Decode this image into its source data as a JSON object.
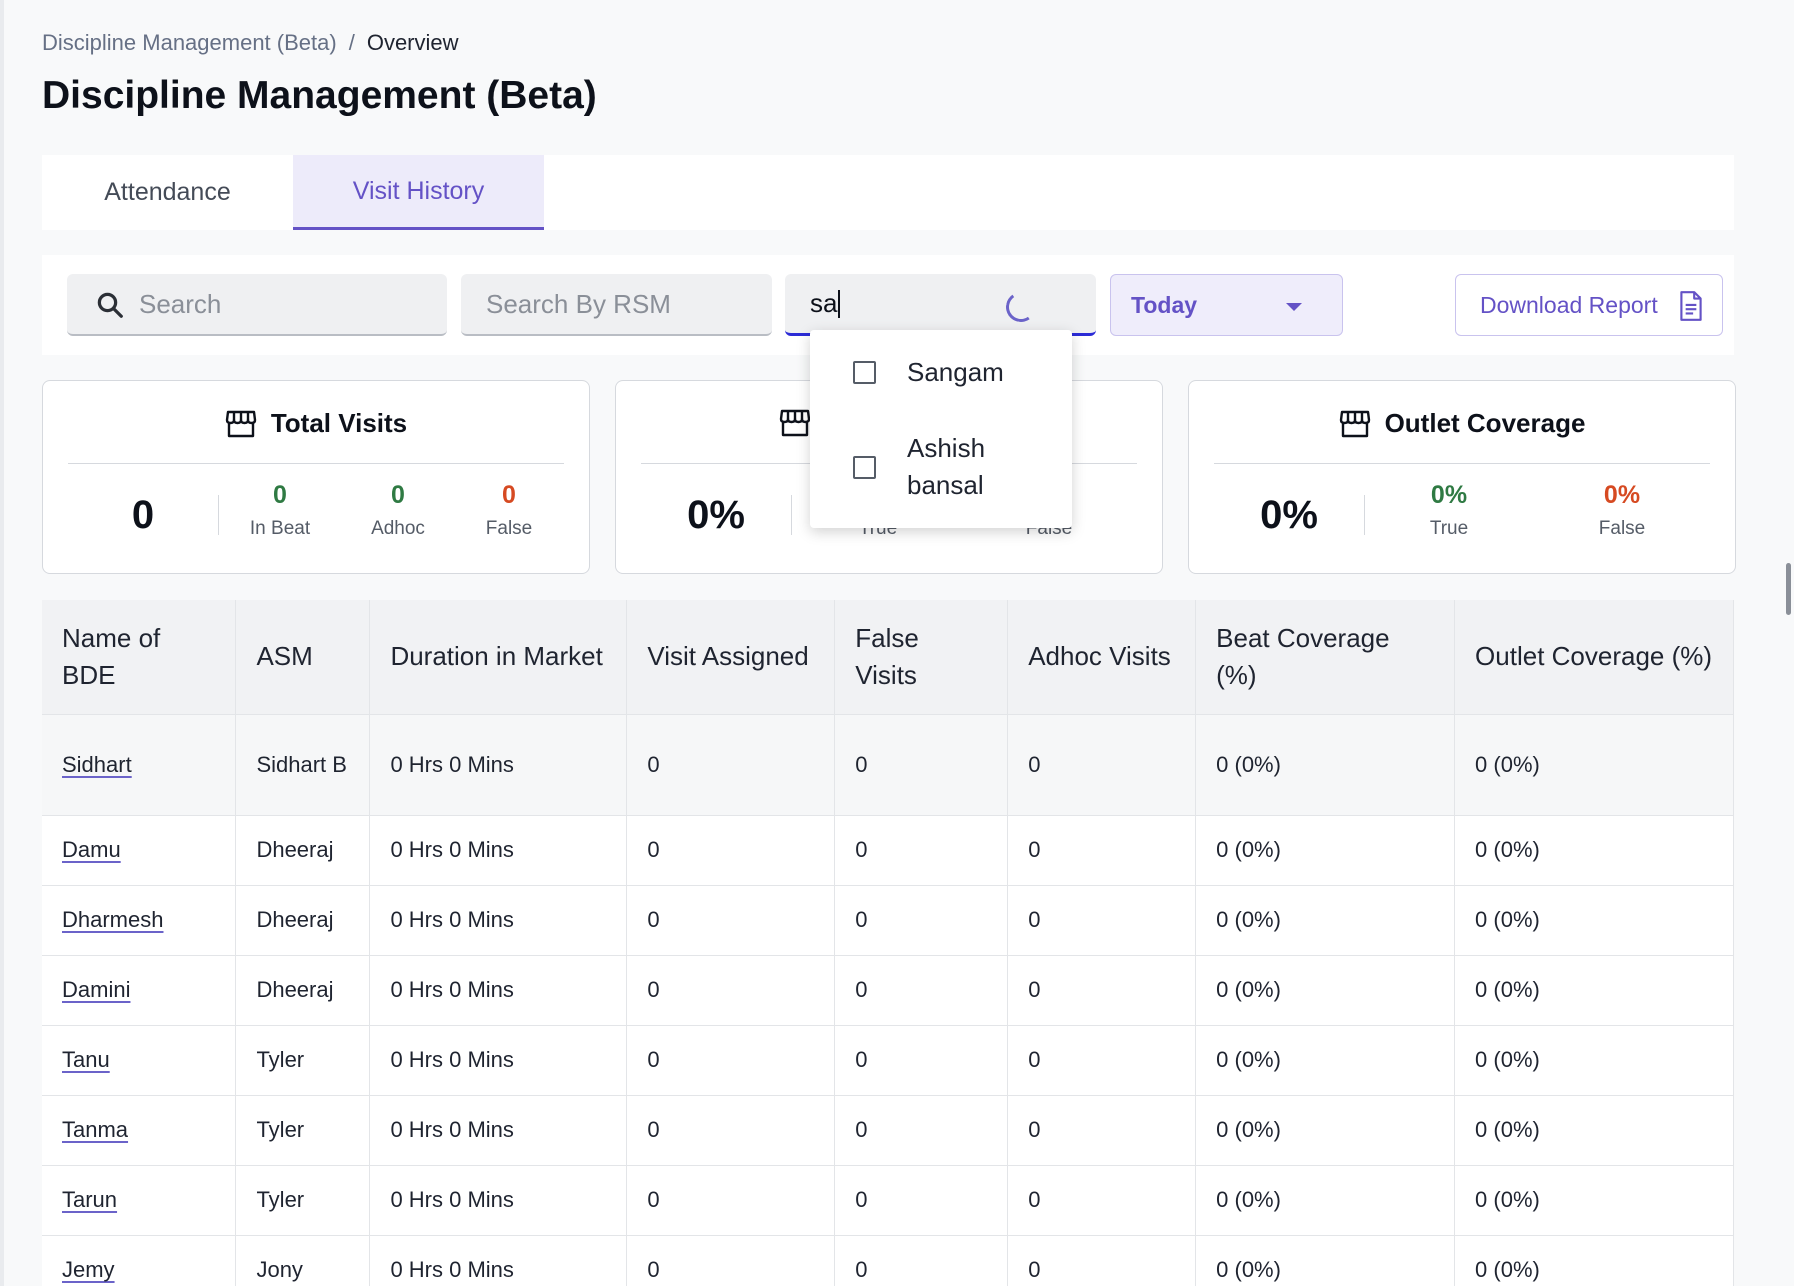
{
  "breadcrumb": {
    "parent": "Discipline Management (Beta)",
    "separator": "/",
    "current": "Overview"
  },
  "page_title": "Discipline Management (Beta)",
  "tabs": [
    {
      "label": "Attendance",
      "active": false
    },
    {
      "label": "Visit History",
      "active": true
    }
  ],
  "filters": {
    "search_placeholder": "Search",
    "rsm_placeholder": "Search By RSM",
    "asm_value": "sa",
    "date_range": "Today",
    "download_label": "Download Report"
  },
  "dropdown": {
    "options": [
      "Sangam",
      "Ashish bansal"
    ],
    "option_lines": [
      [
        "Sangam"
      ],
      [
        "Ashish",
        "bansal"
      ]
    ]
  },
  "cards": [
    {
      "title": "Total Visits",
      "main": "0",
      "stats": [
        {
          "value": "0",
          "label": "In Beat",
          "color": "#2f7a43"
        },
        {
          "value": "0",
          "label": "Adhoc",
          "color": "#2f7a43"
        },
        {
          "value": "0",
          "label": "False",
          "color": "#d64a22"
        }
      ]
    },
    {
      "title": "",
      "main": "0%",
      "stats": [
        {
          "value": "",
          "label": "True",
          "color": "#2f7a43"
        },
        {
          "value": "",
          "label": "False",
          "color": "#d64a22"
        }
      ]
    },
    {
      "title": "Outlet Coverage",
      "main": "0%",
      "stats": [
        {
          "value": "0%",
          "label": "True",
          "color": "#2f7a43"
        },
        {
          "value": "0%",
          "label": "False",
          "color": "#d64a22"
        }
      ]
    }
  ],
  "table": {
    "headers": [
      "Name of BDE",
      "ASM",
      "Duration in Market",
      "Visit Assigned",
      "False Visits",
      "Adhoc Visits",
      "Beat Coverage (%)",
      "Outlet Coverage (%)"
    ],
    "rows": [
      {
        "name": "Sidhart",
        "asm": "Sidhart B",
        "duration": "0 Hrs 0 Mins",
        "assigned": "0",
        "false_visits": "0",
        "adhoc": "0",
        "beat": "0 (0%)",
        "outlet": "0 (0%)"
      },
      {
        "name": "Damu",
        "asm": "Dheeraj",
        "duration": "0 Hrs 0 Mins",
        "assigned": "0",
        "false_visits": "0",
        "adhoc": "0",
        "beat": "0 (0%)",
        "outlet": "0 (0%)"
      },
      {
        "name": "Dharmesh",
        "asm": "Dheeraj",
        "duration": "0 Hrs 0 Mins",
        "assigned": "0",
        "false_visits": "0",
        "adhoc": "0",
        "beat": "0 (0%)",
        "outlet": "0 (0%)"
      },
      {
        "name": "Damini",
        "asm": "Dheeraj",
        "duration": "0 Hrs 0 Mins",
        "assigned": "0",
        "false_visits": "0",
        "adhoc": "0",
        "beat": "0 (0%)",
        "outlet": "0 (0%)"
      },
      {
        "name": "Tanu",
        "asm": "Tyler",
        "duration": "0 Hrs 0 Mins",
        "assigned": "0",
        "false_visits": "0",
        "adhoc": "0",
        "beat": "0 (0%)",
        "outlet": "0 (0%)"
      },
      {
        "name": "Tanma",
        "asm": "Tyler",
        "duration": "0 Hrs 0 Mins",
        "assigned": "0",
        "false_visits": "0",
        "adhoc": "0",
        "beat": "0 (0%)",
        "outlet": "0 (0%)"
      },
      {
        "name": "Tarun",
        "asm": "Tyler",
        "duration": "0 Hrs 0 Mins",
        "assigned": "0",
        "false_visits": "0",
        "adhoc": "0",
        "beat": "0 (0%)",
        "outlet": "0 (0%)"
      },
      {
        "name": "Jemy",
        "asm": "Jony",
        "duration": "0 Hrs 0 Mins",
        "assigned": "0",
        "false_visits": "0",
        "adhoc": "0",
        "beat": "0 (0%)",
        "outlet": "0 (0%)"
      }
    ]
  },
  "colors": {
    "accent": "#6452c6",
    "positive": "#2f7a43",
    "negative": "#d64a22",
    "active_input_border": "#2b2bd6"
  },
  "icons": [
    "search-icon",
    "store-icon",
    "chevron-down-icon",
    "document-icon",
    "loading-spinner-icon",
    "checkbox-icon"
  ]
}
